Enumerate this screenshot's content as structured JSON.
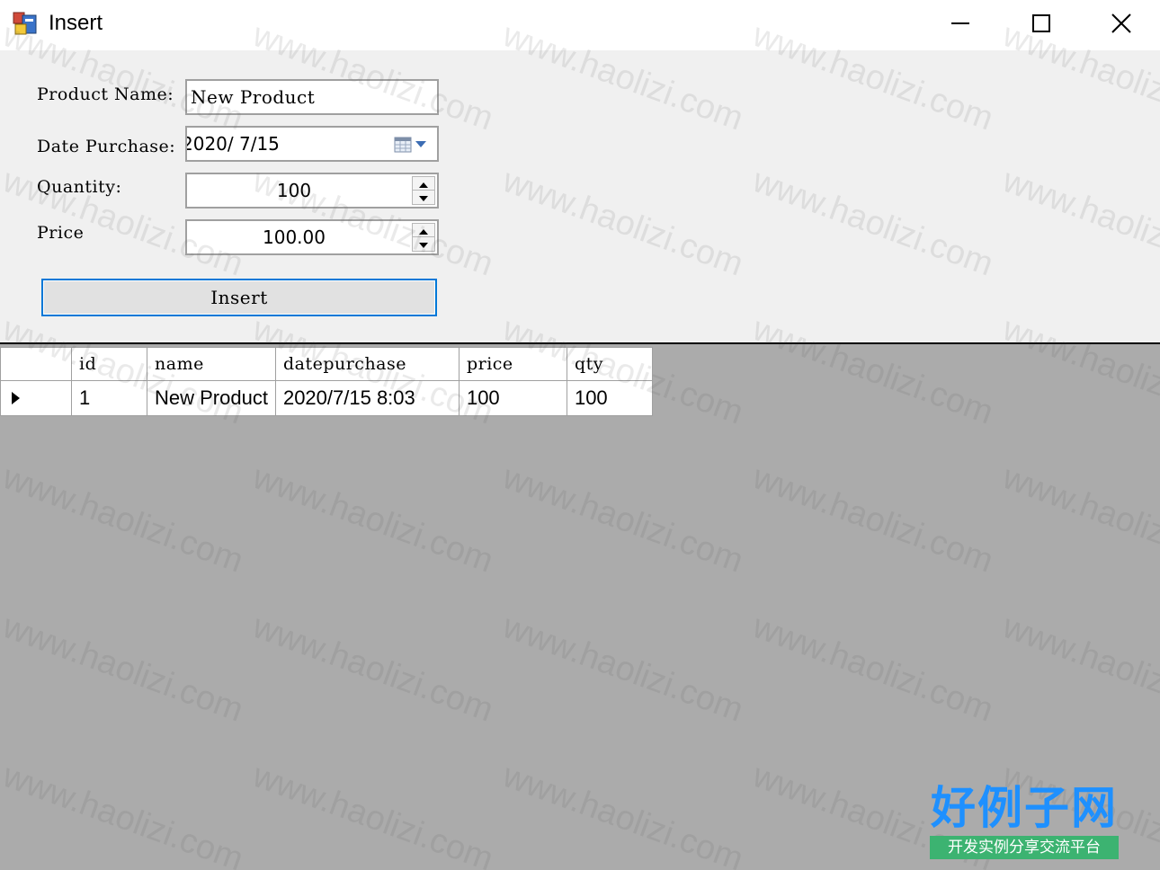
{
  "window": {
    "title": "Insert",
    "icon": "winforms-app-icon",
    "controls": {
      "minimize_icon": "minimize-icon",
      "maximize_icon": "maximize-icon",
      "close_icon": "close-icon"
    }
  },
  "form": {
    "product_name": {
      "label": "Product Name:",
      "value": "New Product"
    },
    "date_purchase": {
      "label": "Date Purchase:",
      "value": "2020/ 7/15",
      "icon": "calendar-dropdown-icon"
    },
    "quantity": {
      "label": "Quantity:",
      "value": "100"
    },
    "price": {
      "label": "Price",
      "value": "100.00"
    },
    "insert_button_label": "Insert"
  },
  "grid": {
    "columns": [
      "id",
      "name",
      "datepurchase",
      "price",
      "qty"
    ],
    "rows": [
      {
        "id": "1",
        "name": "New Product",
        "datepurchase": "2020/7/15 8:03",
        "price": "100",
        "qty": "100"
      }
    ],
    "current_row_icon": "row-pointer-icon"
  },
  "watermark": {
    "text": "www.haolizi.com"
  },
  "logo": {
    "main": "好例子网",
    "sub": "开发实例分享交流平台"
  },
  "colors": {
    "focus_border": "#0078d7",
    "form_bg": "#f0f0f0",
    "grid_bg": "#ababab",
    "logo_blue": "#1e90ff",
    "logo_green": "#3cb371"
  }
}
